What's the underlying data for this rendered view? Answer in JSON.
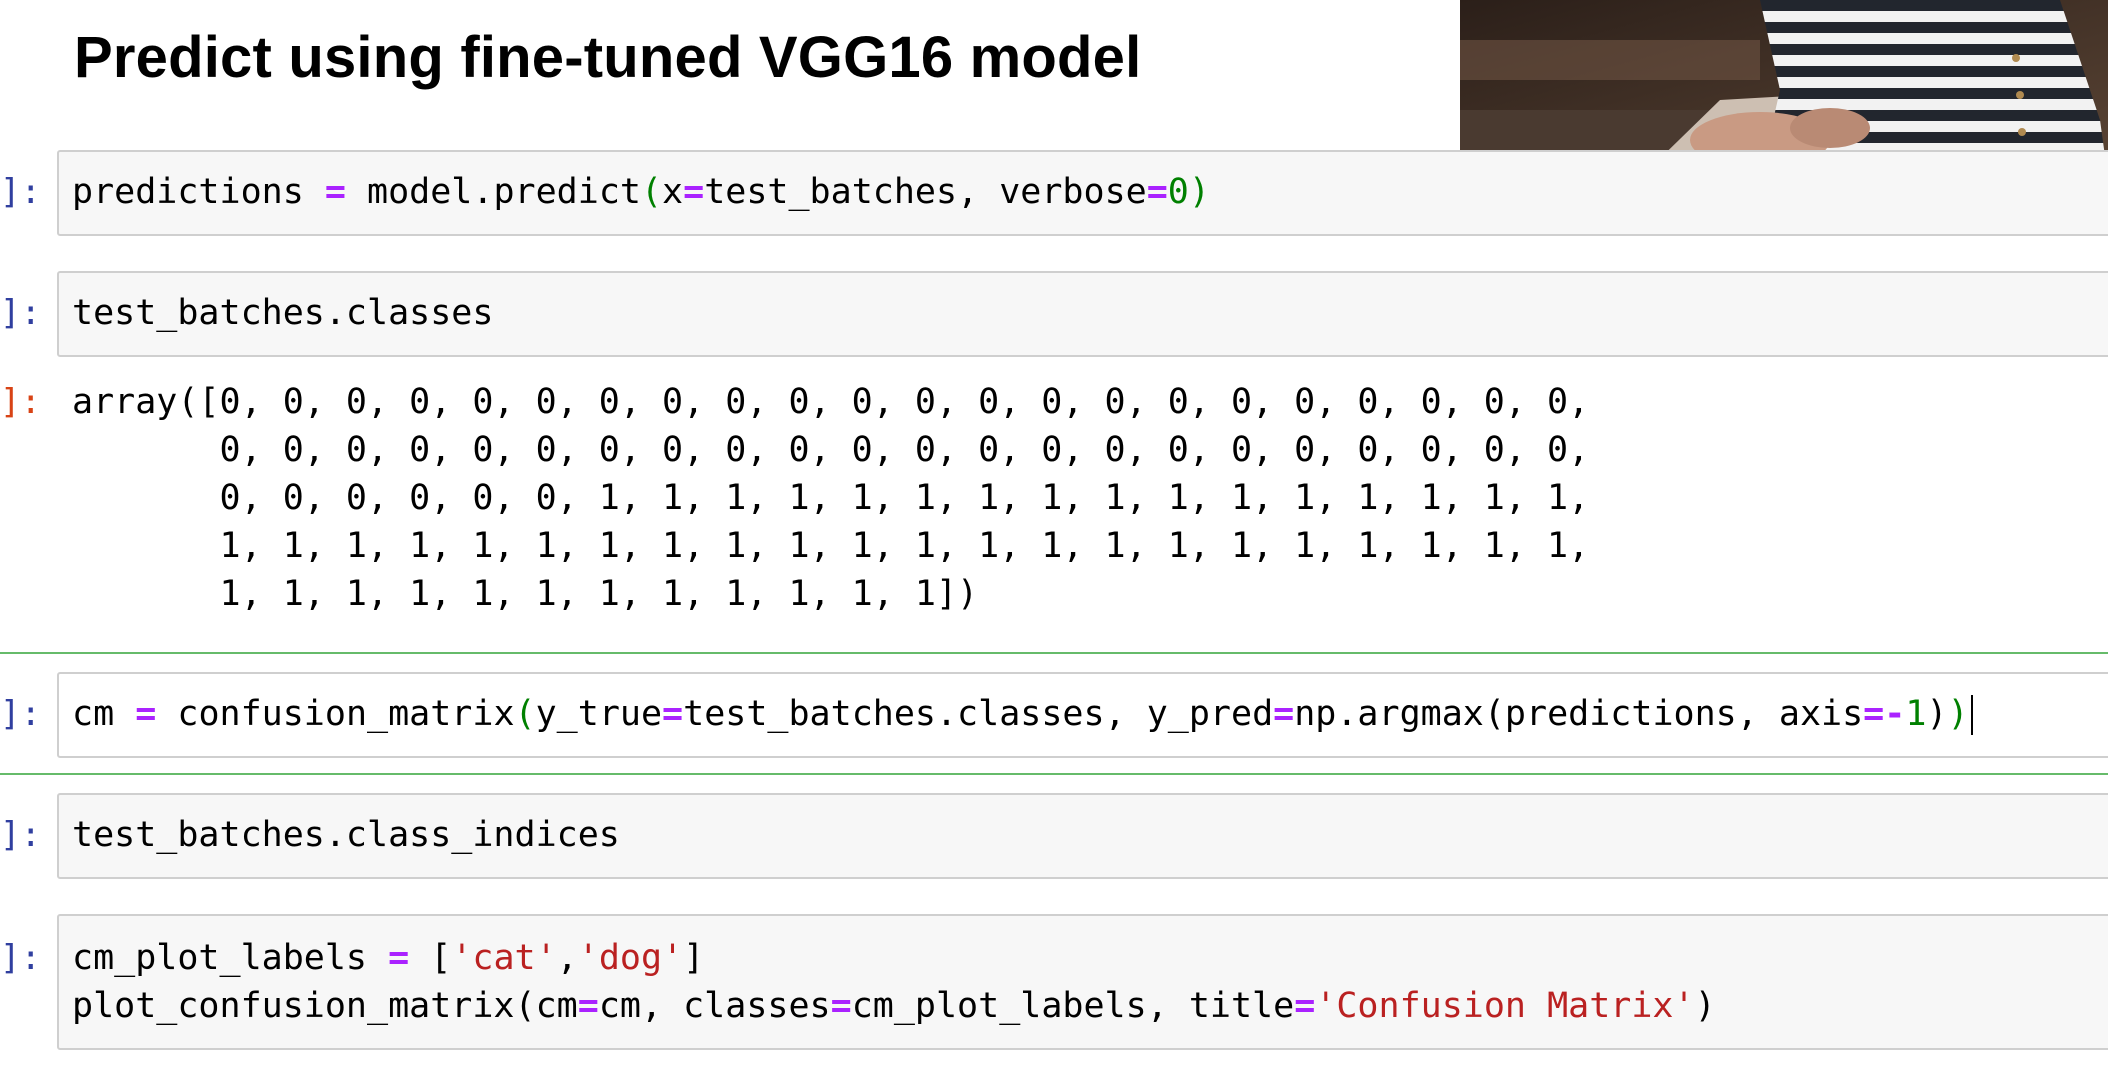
{
  "heading": "Predict using fine-tuned VGG16 model",
  "cells": [
    {
      "prompt": "]:",
      "code": "predictions = model.predict(x=test_batches, verbose=0)"
    },
    {
      "prompt": "]:",
      "code": "test_batches.classes"
    },
    {
      "prompt": "]:",
      "code": "cm = confusion_matrix(y_true=test_batches.classes, y_pred=np.argmax(predictions, axis=-1))"
    },
    {
      "prompt": "]:",
      "code": "test_batches.class_indices"
    },
    {
      "prompt": "]:",
      "code_line1": "cm_plot_labels = ['cat','dog']",
      "code_line2": "plot_confusion_matrix(cm=cm, classes=cm_plot_labels, title='Confusion Matrix')"
    }
  ],
  "output": {
    "prompt": "]:",
    "lines": [
      "array([0, 0, 0, 0, 0, 0, 0, 0, 0, 0, 0, 0, 0, 0, 0, 0, 0, 0, 0, 0, 0, 0,",
      "       0, 0, 0, 0, 0, 0, 0, 0, 0, 0, 0, 0, 0, 0, 0, 0, 0, 0, 0, 0, 0, 0,",
      "       0, 0, 0, 0, 0, 0, 1, 1, 1, 1, 1, 1, 1, 1, 1, 1, 1, 1, 1, 1, 1, 1,",
      "       1, 1, 1, 1, 1, 1, 1, 1, 1, 1, 1, 1, 1, 1, 1, 1, 1, 1, 1, 1, 1, 1,",
      "       1, 1, 1, 1, 1, 1, 1, 1, 1, 1, 1, 1])"
    ]
  },
  "colors": {
    "prompt_in": "#303f9f",
    "prompt_out": "#d84315",
    "operator": "#aa22ff",
    "number": "#008000",
    "string": "#ba2121",
    "selected_border": "#66bb6a"
  }
}
